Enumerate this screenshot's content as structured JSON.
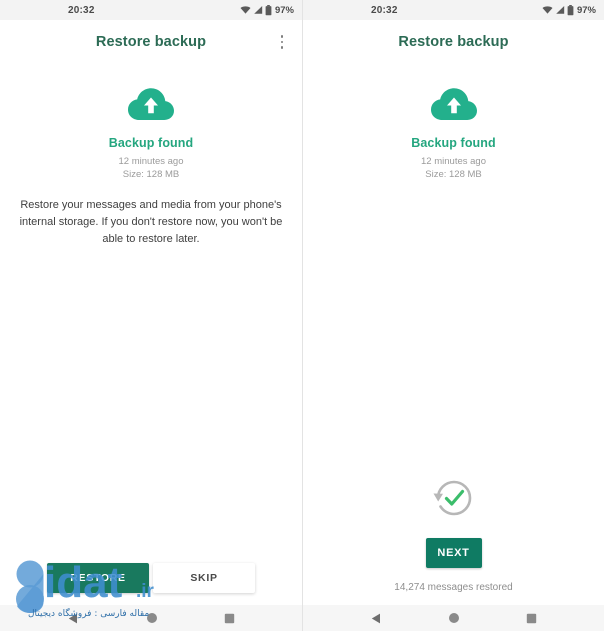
{
  "theme": {
    "accent_green": "#24a67f",
    "title_green": "#2c6b55",
    "restore_button_green": "#19795e",
    "next_button_green": "#0f7b63",
    "status_bar_bg": "#f3f3f3",
    "nav_bar_bg": "#f6f6f6",
    "muted_text": "#9b9b9b",
    "watermark_blue": "#4a90d9"
  },
  "status_bar": {
    "time": "20:32",
    "battery_percent": "97%",
    "icons": [
      "wifi-icon",
      "cellular-signal-icon",
      "battery-icon"
    ]
  },
  "panels": [
    {
      "id": "left",
      "app_bar": {
        "title": "Restore backup",
        "overflow_menu": "overflow-menu-icon",
        "has_overflow_menu": true
      },
      "backup": {
        "icon": "cloud-upload-icon",
        "heading": "Backup found",
        "time_ago": "12 minutes ago",
        "size": "Size: 128 MB",
        "description": "Restore your messages and media from your phone's internal storage. If you don't restore now, you won't be able to restore later."
      },
      "actions": {
        "primary_label": "RESTORE",
        "secondary_label": "SKIP"
      }
    },
    {
      "id": "right",
      "app_bar": {
        "title": "Restore backup",
        "overflow_menu": "overflow-menu-icon",
        "has_overflow_menu": false
      },
      "backup": {
        "icon": "cloud-upload-icon",
        "heading": "Backup found",
        "time_ago": "12 minutes ago",
        "size": "Size: 128 MB",
        "description": ""
      },
      "complete": {
        "icon": "restore-check-icon",
        "next_label": "NEXT",
        "restored_count_text": "14,274 messages restored"
      }
    }
  ],
  "nav_bar": {
    "back": "back-triangle-icon",
    "home": "home-circle-icon",
    "recents": "recents-square-icon"
  },
  "watermark": {
    "brand": "gidat",
    "tld": ".ir",
    "subtitle": "مقاله فارسی : فروشگاه دیجیتال"
  }
}
